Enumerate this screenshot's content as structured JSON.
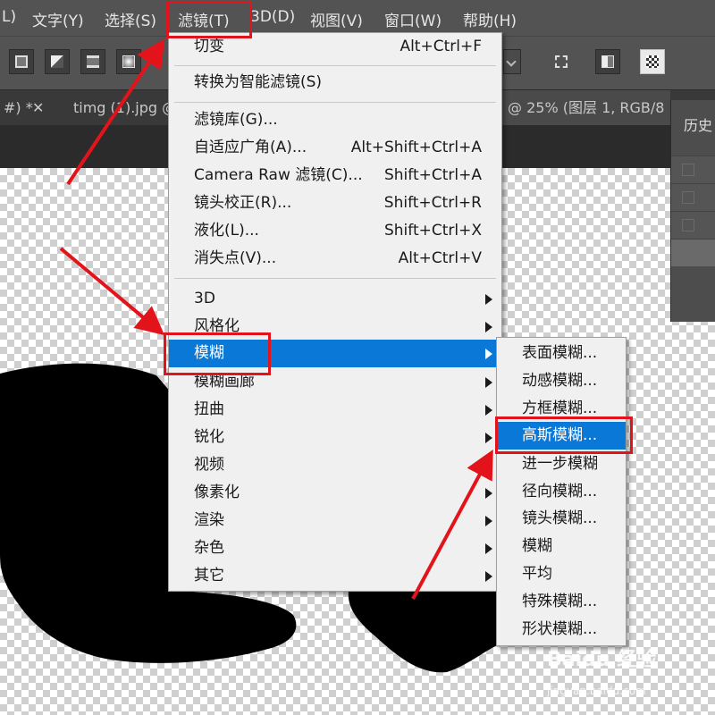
{
  "menubar": {
    "items": [
      "L)",
      "文字(Y)",
      "选择(S)",
      "滤镜(T)",
      "3D(D)",
      "视图(V)",
      "窗口(W)",
      "帮助(H)"
    ]
  },
  "tabs": {
    "tab1": "#) *",
    "tab1_close": "✕",
    "tab2": "timg (1).jpg @",
    "tab3": "@ 25% (图层 1, RGB/8"
  },
  "history_panel": {
    "title": "历史"
  },
  "filter_menu": {
    "items": [
      {
        "label": "切变",
        "shortcut": "Alt+Ctrl+F"
      },
      {
        "label": "转换为智能滤镜(S)",
        "shortcut": ""
      },
      {
        "label": "滤镜库(G)...",
        "shortcut": ""
      },
      {
        "label": "自适应广角(A)...",
        "shortcut": "Alt+Shift+Ctrl+A"
      },
      {
        "label": "Camera Raw 滤镜(C)...",
        "shortcut": "Shift+Ctrl+A"
      },
      {
        "label": "镜头校正(R)...",
        "shortcut": "Shift+Ctrl+R"
      },
      {
        "label": "液化(L)...",
        "shortcut": "Shift+Ctrl+X"
      },
      {
        "label": "消失点(V)...",
        "shortcut": "Alt+Ctrl+V"
      },
      {
        "label": "3D"
      },
      {
        "label": "风格化"
      },
      {
        "label": "模糊"
      },
      {
        "label": "模糊画廊"
      },
      {
        "label": "扭曲"
      },
      {
        "label": "锐化"
      },
      {
        "label": "视频"
      },
      {
        "label": "像素化"
      },
      {
        "label": "渲染"
      },
      {
        "label": "杂色"
      },
      {
        "label": "其它"
      }
    ]
  },
  "blur_submenu": {
    "items": [
      "表面模糊...",
      "动感模糊...",
      "方框模糊...",
      "高斯模糊...",
      "进一步模糊",
      "径向模糊...",
      "镜头模糊...",
      "模糊",
      "平均",
      "特殊模糊...",
      "形状模糊..."
    ]
  },
  "colors": {
    "highlight": "#0a78d7",
    "annotation_red": "#e3131b",
    "ui_dark": "#535353"
  },
  "watermark": {
    "brand": "Baidu 经验",
    "url": "jingyan.baidu.com"
  }
}
